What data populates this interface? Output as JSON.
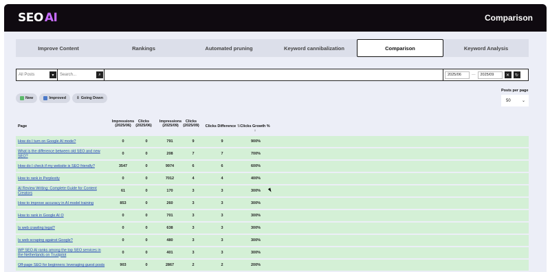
{
  "header": {
    "logo_main": "SEO",
    "logo_ai": "AI",
    "title": "Comparison"
  },
  "tabs": [
    {
      "label": "Improve Content",
      "active": false
    },
    {
      "label": "Rankings",
      "active": false
    },
    {
      "label": "Automated pruning",
      "active": false
    },
    {
      "label": "Keyword cannibalization",
      "active": false
    },
    {
      "label": "Comparison",
      "active": true
    },
    {
      "label": "Keyword Analysis",
      "active": false
    }
  ],
  "filters": {
    "posts_select": "All Posts",
    "search_placeholder": "Search...",
    "date_from": "2025/06",
    "date_sep": "—",
    "date_to": "2025/09"
  },
  "chips": [
    {
      "label": "New",
      "icon": "leaf-icon"
    },
    {
      "label": "Improved",
      "icon": "chart-icon"
    },
    {
      "label": "Going Down",
      "icon": "down-icon"
    }
  ],
  "per_page": {
    "label": "Posts per page",
    "value": "50"
  },
  "table": {
    "columns": {
      "page": "Page",
      "imp1": "Impressions (2025/06)",
      "clk1": "Clicks (2025/06)",
      "imp2": "Impressions (2025/09)",
      "clk2": "Clicks (2025/09)",
      "diff": "Clicks Difference",
      "growth": "Clicks Growth %"
    },
    "rows": [
      {
        "page": "How do I turn on Google AI mode?",
        "imp1": "0",
        "clk1": "0",
        "imp2": "791",
        "clk2": "9",
        "diff": "9",
        "growth": "900%"
      },
      {
        "page": "What is the difference between old SEO and new SEO?",
        "imp1": "0",
        "clk1": "0",
        "imp2": "208",
        "clk2": "7",
        "diff": "7",
        "growth": "700%"
      },
      {
        "page": "How do I check if my website is SEO friendly?",
        "imp1": "3547",
        "clk1": "0",
        "imp2": "9974",
        "clk2": "6",
        "diff": "6",
        "growth": "600%"
      },
      {
        "page": "How to rank in Perplexity",
        "imp1": "0",
        "clk1": "0",
        "imp2": "7012",
        "clk2": "4",
        "diff": "4",
        "growth": "400%"
      },
      {
        "page": "AI Review Writing: Complete Guide for Content Creators",
        "imp1": "61",
        "clk1": "0",
        "imp2": "170",
        "clk2": "3",
        "diff": "3",
        "growth": "300%"
      },
      {
        "page": "How to improve accuracy in AI model training",
        "imp1": "853",
        "clk1": "0",
        "imp2": "260",
        "clk2": "3",
        "diff": "3",
        "growth": "300%"
      },
      {
        "page": "How to rank in Google AI O",
        "imp1": "0",
        "clk1": "0",
        "imp2": "701",
        "clk2": "3",
        "diff": "3",
        "growth": "300%"
      },
      {
        "page": "Is web crawling legal?",
        "imp1": "0",
        "clk1": "0",
        "imp2": "638",
        "clk2": "3",
        "diff": "3",
        "growth": "300%"
      },
      {
        "page": "Is web scraping against Google?",
        "imp1": "0",
        "clk1": "0",
        "imp2": "480",
        "clk2": "3",
        "diff": "3",
        "growth": "300%"
      },
      {
        "page": "WP SEO AI ranks among the top SEO services in the Netherlands on Trustpilot",
        "imp1": "0",
        "clk1": "0",
        "imp2": "401",
        "clk2": "3",
        "diff": "3",
        "growth": "300%"
      },
      {
        "page": "Off-page SEO for beginners: leveraging guest posts",
        "imp1": "903",
        "clk1": "0",
        "imp2": "2867",
        "clk2": "2",
        "diff": "2",
        "growth": "200%"
      }
    ]
  }
}
